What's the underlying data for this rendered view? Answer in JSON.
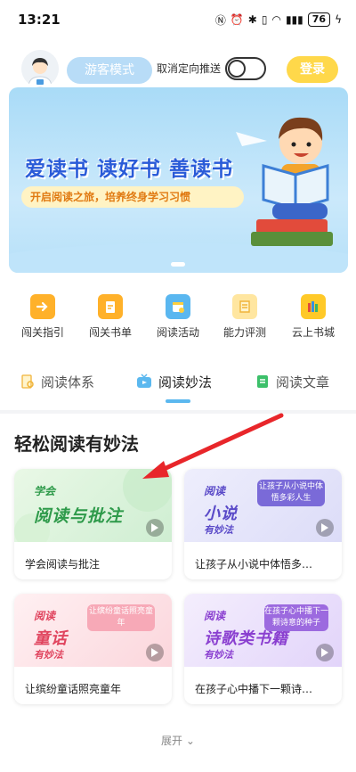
{
  "status_bar": {
    "time": "13:21",
    "battery": "76"
  },
  "header": {
    "guest_mode": "游客模式",
    "push_toggle_label": "取消定向推送",
    "login": "登录"
  },
  "banner": {
    "title": "爱读书 读好书 善读书",
    "subtitle": "开启阅读之旅，培养终身学习习惯"
  },
  "quick_links": [
    {
      "label": "闯关指引",
      "icon": "enter-arrow-icon",
      "color": "#ffb12a"
    },
    {
      "label": "闯关书单",
      "icon": "book-list-icon",
      "color": "#ffb12a"
    },
    {
      "label": "阅读活动",
      "icon": "calendar-icon",
      "color": "#5ab7f0"
    },
    {
      "label": "能力评测",
      "icon": "scroll-icon",
      "color": "#ffd36a"
    },
    {
      "label": "云上书城",
      "icon": "bookshelf-icon",
      "color": "#ffc928"
    }
  ],
  "tabs": [
    {
      "label": "阅读体系",
      "icon": "magnifier-doc-icon"
    },
    {
      "label": "阅读妙法",
      "icon": "tv-icon",
      "active": true
    },
    {
      "label": "阅读文章",
      "icon": "document-icon"
    }
  ],
  "section_title": "轻松阅读有妙法",
  "cards": [
    {
      "title": "学会阅读与批注",
      "thumb_small": "学会",
      "thumb_big": "阅读与批注",
      "thumb_foot": "",
      "bubble": "",
      "bg": "#dff3df",
      "accent": "#2e9a4a"
    },
    {
      "title": "让孩子从小说中体悟多…",
      "thumb_small": "阅读",
      "thumb_big": "小说",
      "thumb_foot": "有妙法",
      "bubble": "让孩子从小说中体悟多彩人生",
      "bg": "#e6e6fb",
      "accent": "#5a4ac8"
    },
    {
      "title": "让缤纷童话照亮童年",
      "thumb_small": "阅读",
      "thumb_big": "童话",
      "thumb_foot": "有妙法",
      "bubble": "让缤纷童话照亮童年",
      "bg": "#fde2e6",
      "accent": "#e0445e"
    },
    {
      "title": "在孩子心中播下一颗诗…",
      "thumb_small": "阅读",
      "thumb_big": "诗歌类书籍",
      "thumb_foot": "有妙法",
      "bubble": "在孩子心中播下一颗诗意的种子",
      "bg": "#ece3fb",
      "accent": "#8a3fd0"
    }
  ],
  "expand_label": "展开",
  "colors": {
    "accent_blue": "#5bb8ef",
    "login_yellow": "#ffd84a",
    "guest_blue": "#b8dcf7",
    "annotation_red": "#e8262a"
  }
}
